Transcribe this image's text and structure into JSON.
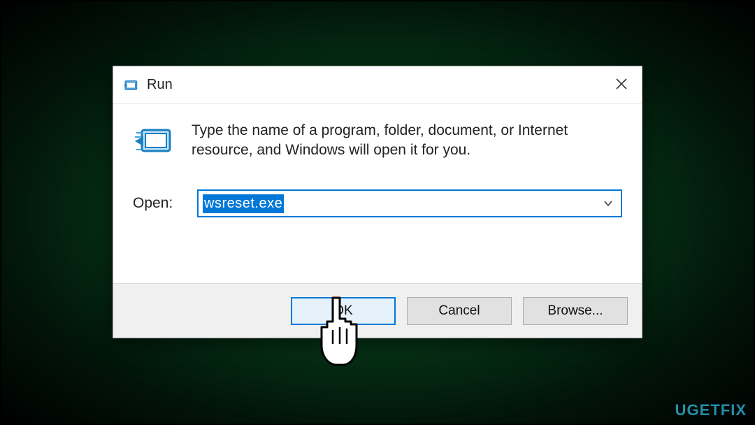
{
  "dialog": {
    "title": "Run",
    "description": "Type the name of a program, folder, document, or Internet resource, and Windows will open it for you.",
    "open_label": "Open:",
    "input_value": "wsreset.exe",
    "buttons": {
      "ok": "OK",
      "cancel": "Cancel",
      "browse": "Browse..."
    }
  },
  "watermark": "UGETFIX"
}
